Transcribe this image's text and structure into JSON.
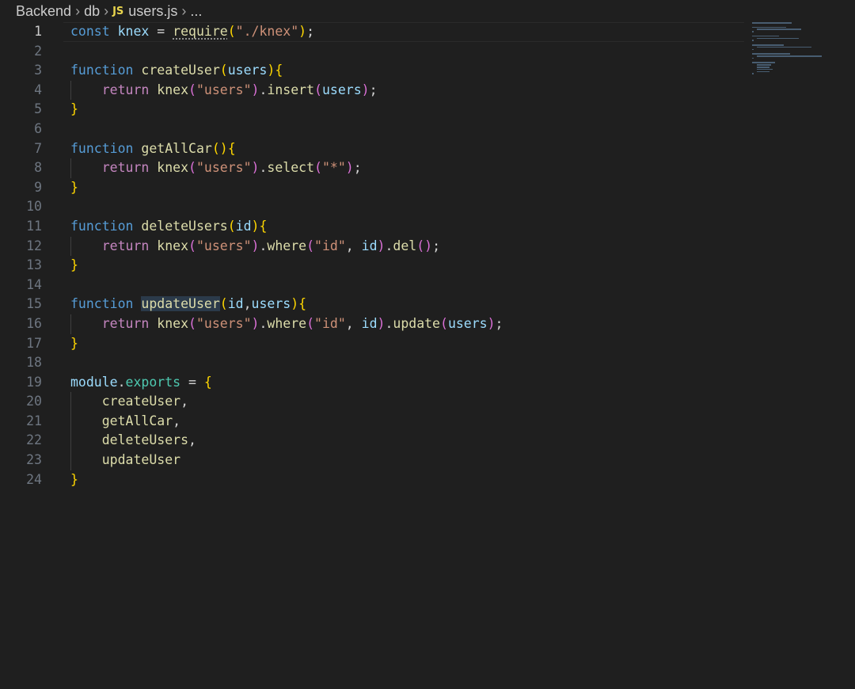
{
  "breadcrumb": {
    "items": [
      "Backend",
      "db",
      "users.js",
      "..."
    ],
    "file_icon": "JS"
  },
  "editor": {
    "language": "javascript",
    "current_line": 1,
    "lines": [
      {
        "n": "1",
        "text": "const knex = require(\"./knex\");"
      },
      {
        "n": "2",
        "text": ""
      },
      {
        "n": "3",
        "text": "function createUser(users){"
      },
      {
        "n": "4",
        "text": "    return knex(\"users\").insert(users);"
      },
      {
        "n": "5",
        "text": "}"
      },
      {
        "n": "6",
        "text": ""
      },
      {
        "n": "7",
        "text": "function getAllCar(){"
      },
      {
        "n": "8",
        "text": "    return knex(\"users\").select(\"*\");"
      },
      {
        "n": "9",
        "text": "}"
      },
      {
        "n": "10",
        "text": ""
      },
      {
        "n": "11",
        "text": "function deleteUsers(id){"
      },
      {
        "n": "12",
        "text": "    return knex(\"users\").where(\"id\", id).del();"
      },
      {
        "n": "13",
        "text": "}"
      },
      {
        "n": "14",
        "text": ""
      },
      {
        "n": "15",
        "text": "function updateUser(id,users){"
      },
      {
        "n": "16",
        "text": "    return knex(\"users\").where(\"id\", id).update(users);"
      },
      {
        "n": "17",
        "text": "}"
      },
      {
        "n": "18",
        "text": ""
      },
      {
        "n": "19",
        "text": "module.exports = {"
      },
      {
        "n": "20",
        "text": "    createUser,"
      },
      {
        "n": "21",
        "text": "    getAllCar,"
      },
      {
        "n": "22",
        "text": "    deleteUsers,"
      },
      {
        "n": "23",
        "text": "    updateUser"
      },
      {
        "n": "24",
        "text": "}"
      }
    ]
  },
  "colors": {
    "background": "#1f1f1f",
    "keyword": "#569cd6",
    "function": "#dcdcaa",
    "string": "#ce9178",
    "variable": "#9cdcfe",
    "bracket_gold": "#ffd700",
    "bracket_purple": "#da70d6",
    "bracket_blue": "#179fff",
    "js_icon": "#e8d44d"
  }
}
